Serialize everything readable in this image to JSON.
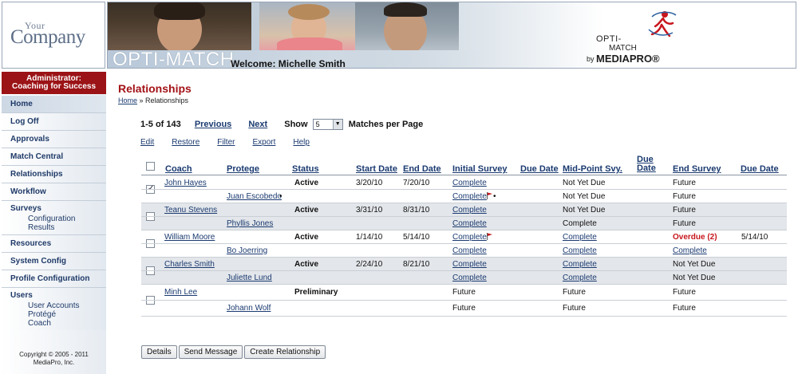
{
  "header": {
    "logo_top": "Your",
    "logo_bottom": "Company",
    "app_title": "OPTI-MATCH",
    "welcome": "Welcome: Michelle Smith",
    "brand_line1": "OPTI-",
    "brand_line2": "MATCH",
    "brand_by": "by",
    "brand_name": "MEDIAPRO®"
  },
  "sidebar": {
    "role_line1": "Administrator:",
    "role_line2": "Coaching for Success",
    "items": [
      {
        "label": "Home"
      },
      {
        "label": "Log Off"
      },
      {
        "label": "Approvals"
      },
      {
        "label": "Match Central"
      },
      {
        "label": "Relationships"
      },
      {
        "label": "Workflow"
      }
    ],
    "surveys": {
      "label": "Surveys",
      "sub": [
        "Configuration",
        "Results"
      ]
    },
    "items2": [
      {
        "label": "Resources"
      },
      {
        "label": "System Config"
      },
      {
        "label": "Profile Configuration"
      }
    ],
    "users": {
      "label": "Users",
      "sub": [
        "User Accounts",
        "Protégé",
        "Coach"
      ]
    },
    "copyright_line1": "Copyright © 2005 - 2011",
    "copyright_line2": "MediaPro, Inc."
  },
  "main": {
    "title": "Relationships",
    "breadcrumb_home": "Home",
    "breadcrumb_sep": " » ",
    "breadcrumb_current": "Relationships",
    "pager": {
      "range": "1-5 of 143",
      "previous": "Previous",
      "next": "Next",
      "show": "Show",
      "page_size": "5",
      "suffix": "Matches per Page"
    },
    "actions": [
      "Edit",
      "Restore",
      "Filter",
      "Export",
      "Help"
    ],
    "columns": {
      "coach": "Coach",
      "protege": "Protege",
      "status": "Status",
      "start_date": "Start Date",
      "end_date": "End Date",
      "initial_survey": "Initial Survey",
      "due_date_1": "Due Date",
      "midpoint": "Mid-Point Svy.",
      "due_date_2": "Due Date",
      "end_survey": "End Survey",
      "due_date_3": "Due Date"
    },
    "rows": [
      {
        "checked": true,
        "coach": "John Hayes",
        "status": "Active",
        "start": "3/20/10",
        "end": "7/20/10",
        "coach_initial": "Complete",
        "coach_initial_flag": false,
        "coach_initial_dot": false,
        "coach_mid": "Not Yet Due",
        "coach_mid_link": false,
        "coach_end": "Future",
        "coach_end_style": "plain",
        "coach_end_due": "",
        "protege": "Juan Escobedo",
        "protege_dot": true,
        "protege_initial": "Complete",
        "protege_initial_flag": true,
        "protege_initial_dot": true,
        "protege_mid": "Not Yet Due",
        "protege_mid_link": false,
        "protege_end": "Future",
        "protege_end_link": false
      },
      {
        "checked": false,
        "coach": "Teanu Stevens",
        "status": "Active",
        "start": "3/31/10",
        "end": "8/31/10",
        "coach_initial": "Complete",
        "coach_initial_flag": false,
        "coach_initial_dot": false,
        "coach_mid": "Not Yet Due",
        "coach_mid_link": false,
        "coach_end": "Future",
        "coach_end_style": "plain",
        "coach_end_due": "",
        "protege": "Phyllis Jones",
        "protege_dot": false,
        "protege_initial": "Complete",
        "protege_initial_flag": false,
        "protege_initial_dot": false,
        "protege_mid": "Complete",
        "protege_mid_link": false,
        "protege_end": "Future",
        "protege_end_link": false
      },
      {
        "checked": false,
        "coach": "William Moore",
        "status": "Active",
        "start": "1/14/10",
        "end": "5/14/10",
        "coach_initial": "Complete",
        "coach_initial_flag": true,
        "coach_initial_dot": false,
        "coach_mid": "Complete",
        "coach_mid_link": true,
        "coach_end": "Overdue (2)",
        "coach_end_style": "overdue",
        "coach_end_due": "5/14/10",
        "protege": "Bo Joerring",
        "protege_dot": false,
        "protege_initial": "Complete",
        "protege_initial_flag": false,
        "protege_initial_dot": false,
        "protege_mid": "Complete",
        "protege_mid_link": true,
        "protege_end": "Complete",
        "protege_end_link": true
      },
      {
        "checked": false,
        "coach": "Charles Smith",
        "status": "Active",
        "start": "2/24/10",
        "end": "8/21/10",
        "coach_initial": "Complete",
        "coach_initial_flag": false,
        "coach_initial_dot": false,
        "coach_mid": "Complete",
        "coach_mid_link": true,
        "coach_end": "Not Yet Due",
        "coach_end_style": "plain",
        "coach_end_due": "",
        "protege": "Juliette Lund",
        "protege_dot": false,
        "protege_initial": "Complete",
        "protege_initial_flag": false,
        "protege_initial_dot": false,
        "protege_mid": "Complete",
        "protege_mid_link": true,
        "protege_end": "Not Yet Due",
        "protege_end_link": false
      },
      {
        "checked": false,
        "coach": "Minh Lee",
        "status": "Preliminary",
        "start": "",
        "end": "",
        "coach_initial": "Future",
        "coach_initial_plain": true,
        "coach_initial_flag": false,
        "coach_initial_dot": false,
        "coach_mid": "Future",
        "coach_mid_link": false,
        "coach_end": "Future",
        "coach_end_style": "plain",
        "coach_end_due": "",
        "protege": "Johann Wolf",
        "protege_dot": false,
        "protege_initial": "Future",
        "protege_initial_plain": true,
        "protege_initial_flag": false,
        "protege_initial_dot": false,
        "protege_mid": "Future",
        "protege_mid_link": false,
        "protege_end": "Future",
        "protege_end_link": false
      }
    ],
    "buttons": [
      "Details",
      "Send Message",
      "Create Relationship"
    ]
  },
  "colors": {
    "accent_red": "#9b1316",
    "title_red": "#a31217",
    "link_blue": "#1a3a70",
    "overdue_red": "#c8161c",
    "row_shade": "#e3e6ea"
  }
}
